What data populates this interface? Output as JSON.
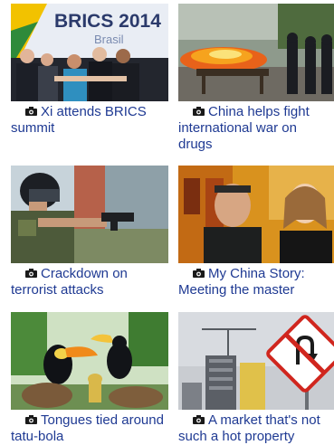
{
  "stories": [
    {
      "caption": "Xi attends BRICS summit",
      "image_text_1": "BRICS 2014",
      "image_text_2": "Brasil",
      "icon": "camera-icon"
    },
    {
      "caption": "China helps fight international war on drugs",
      "icon": "camera-icon"
    },
    {
      "caption": "Crackdown on terrorist attacks",
      "icon": "camera-icon"
    },
    {
      "caption": "My China Story: Meeting the master",
      "icon": "camera-icon"
    },
    {
      "caption": "Tongues tied around tatu-bola",
      "icon": "camera-icon"
    },
    {
      "caption": "A market that's not such a hot property",
      "icon": "camera-icon"
    }
  ],
  "colors": {
    "caption_link": "#1f3a93"
  }
}
